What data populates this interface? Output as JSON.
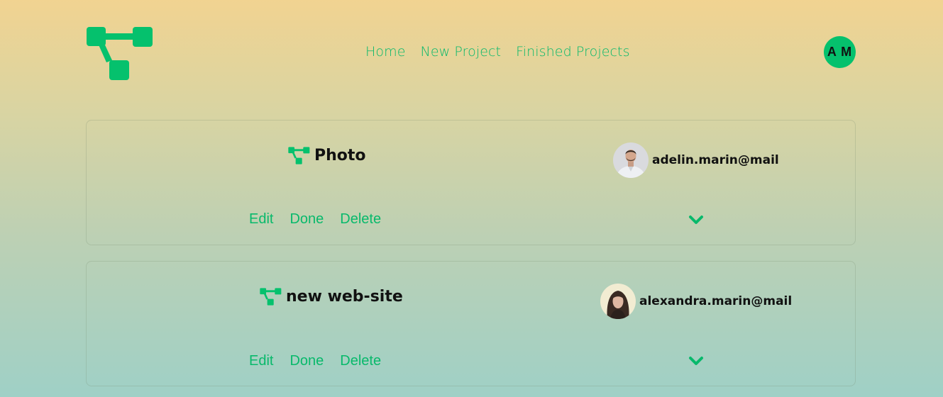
{
  "brand": {
    "logo_icon": "project-tree-logo",
    "accent_color": "#05c16d"
  },
  "nav": {
    "items": [
      {
        "label": "Home"
      },
      {
        "label": "New Project"
      },
      {
        "label": "Finished Projects"
      }
    ]
  },
  "user": {
    "initials": "A M"
  },
  "projects": [
    {
      "title": "Photo",
      "icon": "project-tree-icon",
      "owner_email": "adelin.marin@mail",
      "owner_avatar": "male-avatar-photo",
      "actions": {
        "edit": "Edit",
        "done": "Done",
        "delete": "Delete"
      },
      "expand_icon": "chevron-down-icon"
    },
    {
      "title": "new web-site",
      "icon": "project-tree-icon",
      "owner_email": "alexandra.marin@mail",
      "owner_avatar": "female-avatar-photo",
      "actions": {
        "edit": "Edit",
        "done": "Done",
        "delete": "Delete"
      },
      "expand_icon": "chevron-down-icon"
    }
  ]
}
